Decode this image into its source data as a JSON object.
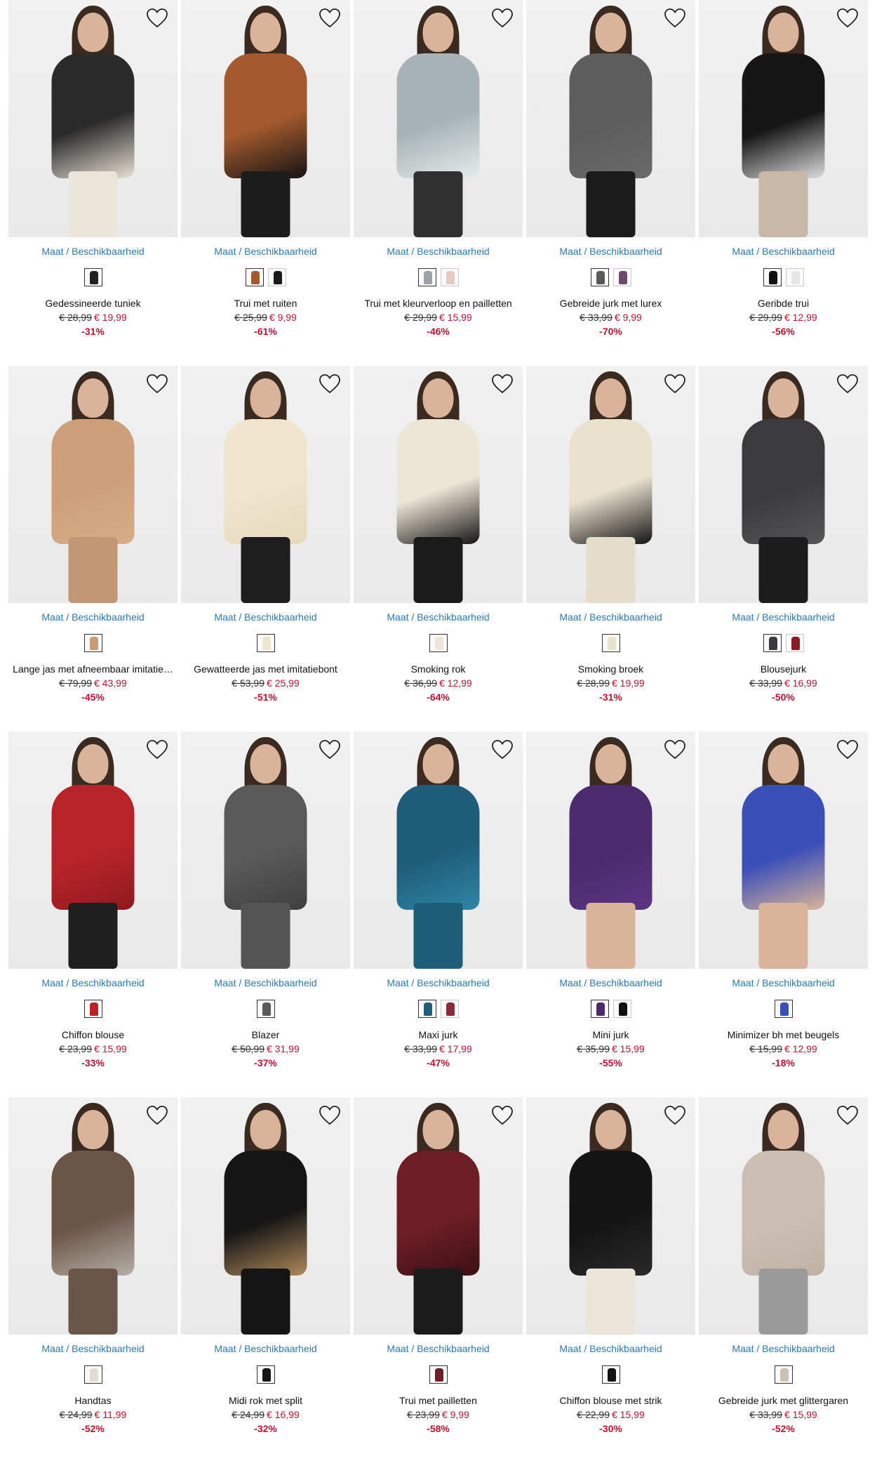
{
  "size_link_label": "Maat / Beschikbaarheid",
  "colors": {
    "link": "#2a7ab8",
    "sale": "#c8102e"
  },
  "products": [
    {
      "name": "Gedessineerde tuniek",
      "old_price": "€ 28,99",
      "new_price": "€ 19,99",
      "discount": "-31%",
      "outfit": "#2b2b2b",
      "accent": "#e8e2d6",
      "legs": "#ece6da",
      "swatches": [
        "#222222"
      ]
    },
    {
      "name": "Trui met ruiten",
      "old_price": "€ 25,99",
      "new_price": "€ 9,99",
      "discount": "-61%",
      "outfit": "#a45a2e",
      "accent": "#141414",
      "legs": "#1c1c1c",
      "swatches": [
        "#a45a2e",
        "#1a1a1a"
      ]
    },
    {
      "name": "Trui met kleurverloop en pailletten",
      "old_price": "€ 29,99",
      "new_price": "€ 15,99",
      "discount": "-46%",
      "outfit": "#a9b3b6",
      "accent": "#e7ecec",
      "legs": "#303030",
      "swatches": [
        "#9aa3a6",
        "#e9c9c4"
      ]
    },
    {
      "name": "Gebreide jurk met lurex",
      "old_price": "€ 33,99",
      "new_price": "€ 9,99",
      "discount": "-70%",
      "outfit": "#5d5d5d",
      "accent": "#6a6a6a",
      "legs": "#1b1b1b",
      "swatches": [
        "#595959",
        "#6b4a6e"
      ]
    },
    {
      "name": "Geribde trui",
      "old_price": "€ 29,99",
      "new_price": "€ 12,99",
      "discount": "-56%",
      "outfit": "#161616",
      "accent": "#dddddd",
      "legs": "#c9b8a8",
      "swatches": [
        "#111111",
        "#e6e6e6"
      ]
    },
    {
      "name": "Lange jas met afneembaar imitatie…",
      "old_price": "€ 79,99",
      "new_price": "€ 43,99",
      "discount": "-45%",
      "outfit": "#cda07a",
      "accent": "#d6ad88",
      "legs": "#c49774",
      "swatches": [
        "#c99c77"
      ]
    },
    {
      "name": "Gewatteerde jas met imitatiebont",
      "old_price": "€ 53,99",
      "new_price": "€ 25,99",
      "discount": "-51%",
      "outfit": "#efe4cc",
      "accent": "#e6dabd",
      "legs": "#1e1e1e",
      "swatches": [
        "#efe4cc"
      ]
    },
    {
      "name": "Smoking rok",
      "old_price": "€ 36,99",
      "new_price": "€ 12,99",
      "discount": "-64%",
      "outfit": "#ece6d6",
      "accent": "#141414",
      "legs": "#1a1a1a",
      "swatches": [
        "#ece6d6"
      ]
    },
    {
      "name": "Smoking broek",
      "old_price": "€ 28,99",
      "new_price": "€ 19,99",
      "discount": "-31%",
      "outfit": "#e9e2cf",
      "accent": "#141414",
      "legs": "#e5ddc9",
      "swatches": [
        "#e9e2cf"
      ]
    },
    {
      "name": "Blousejurk",
      "old_price": "€ 33,99",
      "new_price": "€ 16,99",
      "discount": "-50%",
      "outfit": "#3a3a3f",
      "accent": "#55555a",
      "legs": "#1c1c1c",
      "swatches": [
        "#3a3a3f",
        "#8a1a24"
      ]
    },
    {
      "name": "Chiffon blouse",
      "old_price": "€ 23,99",
      "new_price": "€ 15,99",
      "discount": "-33%",
      "outfit": "#b8232a",
      "accent": "#8d1a1f",
      "legs": "#1f1f1f",
      "swatches": [
        "#b8232a"
      ]
    },
    {
      "name": "Blazer",
      "old_price": "€ 50,99",
      "new_price": "€ 31,99",
      "discount": "-37%",
      "outfit": "#595959",
      "accent": "#3f3f3f",
      "legs": "#555555",
      "swatches": [
        "#595959"
      ]
    },
    {
      "name": "Maxi jurk",
      "old_price": "€ 33,99",
      "new_price": "€ 17,99",
      "discount": "-47%",
      "outfit": "#1f5d7a",
      "accent": "#2e86a6",
      "legs": "#1f5d7a",
      "swatches": [
        "#1f5d7a",
        "#8a2a3a"
      ]
    },
    {
      "name": "Mini jurk",
      "old_price": "€ 35,99",
      "new_price": "€ 15,99",
      "discount": "-55%",
      "outfit": "#4b2a6e",
      "accent": "#5c3582",
      "legs": "#d9b49a",
      "swatches": [
        "#4b2a6e",
        "#111111"
      ]
    },
    {
      "name": "Minimizer bh met beugels",
      "old_price": "€ 15,99",
      "new_price": "€ 12,99",
      "discount": "-18%",
      "outfit": "#3b4fb8",
      "accent": "#d9b49a",
      "legs": "#d9b49a",
      "swatches": [
        "#3b4fb8"
      ]
    },
    {
      "name": "Handtas",
      "old_price": "€ 24,99",
      "new_price": "€ 11,99",
      "discount": "-52%",
      "outfit": "#6b5547",
      "accent": "#b5b0a6",
      "legs": "#6b5547",
      "swatches": [
        "#e2ddd4"
      ]
    },
    {
      "name": "Midi rok met split",
      "old_price": "€ 24,99",
      "new_price": "€ 16,99",
      "discount": "-32%",
      "outfit": "#151515",
      "accent": "#b08a5a",
      "legs": "#151515",
      "swatches": [
        "#151515"
      ]
    },
    {
      "name": "Trui met pailletten",
      "old_price": "€ 23,99",
      "new_price": "€ 9,99",
      "discount": "-58%",
      "outfit": "#6e1f26",
      "accent": "#3a1014",
      "legs": "#1a1a1a",
      "swatches": [
        "#6e1f26"
      ]
    },
    {
      "name": "Chiffon blouse met strik",
      "old_price": "€ 22,99",
      "new_price": "€ 15,99",
      "discount": "-30%",
      "outfit": "#141414",
      "accent": "#2a2a2a",
      "legs": "#ece6da",
      "swatches": [
        "#141414"
      ]
    },
    {
      "name": "Gebreide jurk met glittergaren",
      "old_price": "€ 33,99",
      "new_price": "€ 15,99",
      "discount": "-52%",
      "outfit": "#cbbfb3",
      "accent": "#bfb2a5",
      "legs": "#9a9a9a",
      "swatches": [
        "#cbbfb3"
      ]
    }
  ]
}
